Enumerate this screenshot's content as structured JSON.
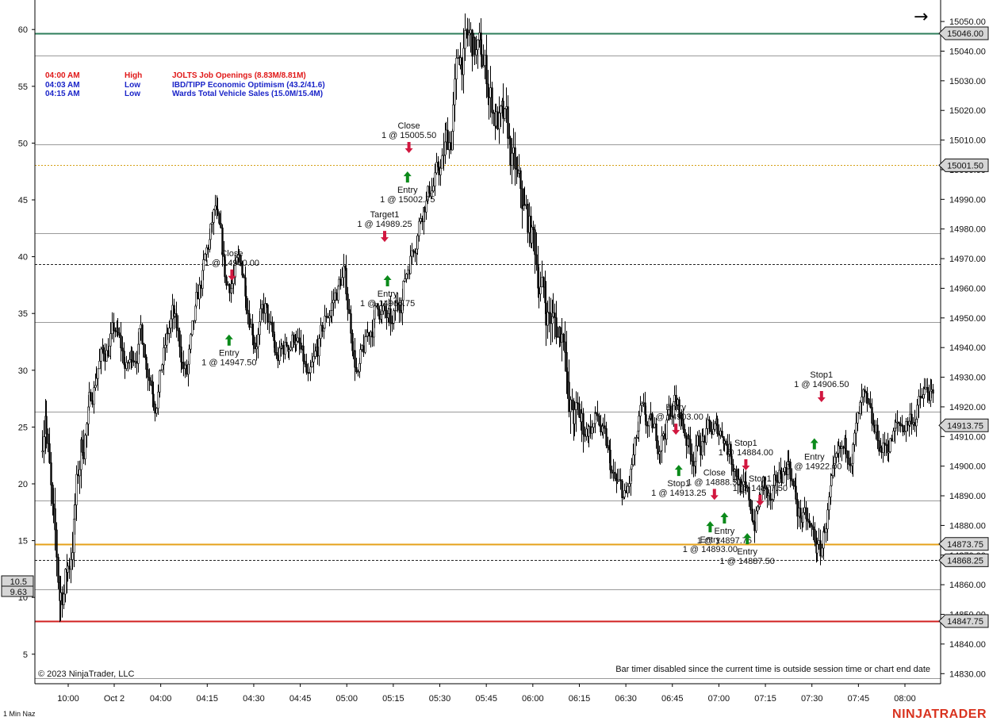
{
  "chart": {
    "instrument": "1 Min Naz",
    "copyright": "© 2023 NinjaTrader, LLC",
    "brand": "NINJATRADER",
    "bar_timer": "Bar timer disabled since the current time is outside session time or chart end date",
    "arrow_glyph": "→",
    "colors": {
      "bg": "#ffffff",
      "candle": "#000000",
      "green_line": "#2e7d5b",
      "red_line": "#d11f1f",
      "orange_line": "#e6a21a",
      "gold_dotted": "#d4a017",
      "brand": "#d9331f",
      "buy": "#0b8a1a",
      "sell": "#d1173f"
    }
  },
  "events": [
    {
      "time": "04:00 AM",
      "impact": "High",
      "title": "JOLTS Job Openings (8.83M/8.81M)",
      "color": "#e01818"
    },
    {
      "time": "04:03 AM",
      "impact": "Low",
      "title": "IBD/TIPP Economic Optimism (43.2/41.6)",
      "color": "#1a24c8"
    },
    {
      "time": "04:15 AM",
      "impact": "Low",
      "title": "Wards Total Vehicle Sales (15.0M/15.4M)",
      "color": "#1a24c8"
    }
  ],
  "chart_data": {
    "type": "candlestick",
    "x_ticks": [
      "10:00",
      "Oct 2",
      "04:00",
      "04:15",
      "04:30",
      "04:45",
      "05:00",
      "05:15",
      "05:30",
      "05:45",
      "06:00",
      "06:15",
      "06:30",
      "06:45",
      "07:00",
      "07:15",
      "07:30",
      "07:45",
      "08:00"
    ],
    "right_axis": {
      "ticks": [
        15050,
        15040,
        15030,
        15020,
        15010,
        15000,
        14990,
        14980,
        14970,
        14960,
        14950,
        14940,
        14930,
        14920,
        14910,
        14900,
        14890,
        14880,
        14870,
        14860,
        14850,
        14840,
        14830
      ],
      "range": [
        14826.6,
        15057.25
      ],
      "decimals": 2
    },
    "left_axis": {
      "ticks": [
        60,
        55,
        50,
        45,
        40,
        35,
        30,
        25,
        20,
        15,
        10,
        5
      ],
      "range": [
        2.4,
        62.6
      ]
    },
    "price_labels": [
      {
        "value": 15046.0,
        "style": "green"
      },
      {
        "value": 15001.5,
        "style": "gray"
      },
      {
        "value": 14913.75,
        "style": "gray"
      },
      {
        "value": 14873.75,
        "style": "gray"
      },
      {
        "value": 14868.25,
        "style": "gray"
      },
      {
        "value": 14847.75,
        "style": "gray"
      }
    ],
    "left_labels": [
      "10.5",
      "9.63"
    ],
    "levels": [
      {
        "value": 15046.0,
        "style": "green"
      },
      {
        "value": 15038.5,
        "style": "gray"
      },
      {
        "value": 15008.5,
        "style": "gray"
      },
      {
        "value": 15001.5,
        "style": "gold-dotted"
      },
      {
        "value": 14978.5,
        "style": "gray"
      },
      {
        "value": 14968.25,
        "style": "dashed"
      },
      {
        "value": 14948.5,
        "style": "gray"
      },
      {
        "value": 14918.5,
        "style": "gray"
      },
      {
        "value": 14888.5,
        "style": "gray"
      },
      {
        "value": 14873.75,
        "style": "orange"
      },
      {
        "value": 14868.25,
        "style": "dashed"
      },
      {
        "value": 14858.5,
        "style": "gray"
      },
      {
        "value": 14847.75,
        "style": "red"
      },
      {
        "value": 14828.5,
        "style": "gray"
      }
    ],
    "anchors": [
      {
        "t": 0,
        "p": 14905
      },
      {
        "t": 3,
        "p": 14925
      },
      {
        "t": 8,
        "p": 14880
      },
      {
        "t": 13,
        "p": 14855
      },
      {
        "t": 20,
        "p": 14868
      },
      {
        "t": 28,
        "p": 14905
      },
      {
        "t": 40,
        "p": 14935
      },
      {
        "t": 52,
        "p": 14945
      },
      {
        "t": 60,
        "p": 14932
      },
      {
        "t": 70,
        "p": 14945
      },
      {
        "t": 80,
        "p": 14925
      },
      {
        "t": 92,
        "p": 14950
      },
      {
        "t": 102,
        "p": 14930
      },
      {
        "t": 112,
        "p": 14960
      },
      {
        "t": 122,
        "p": 14985
      },
      {
        "t": 130,
        "p": 14960
      },
      {
        "t": 140,
        "p": 14968
      },
      {
        "t": 150,
        "p": 14945
      },
      {
        "t": 157,
        "p": 14952
      },
      {
        "t": 165,
        "p": 14935
      },
      {
        "t": 178,
        "p": 14945
      },
      {
        "t": 188,
        "p": 14925
      },
      {
        "t": 200,
        "p": 14950
      },
      {
        "t": 212,
        "p": 14965
      },
      {
        "t": 222,
        "p": 14930
      },
      {
        "t": 236,
        "p": 14955
      },
      {
        "t": 246,
        "p": 14945
      },
      {
        "t": 257,
        "p": 14968
      },
      {
        "t": 268,
        "p": 14990
      },
      {
        "t": 280,
        "p": 15000
      },
      {
        "t": 287,
        "p": 15012
      },
      {
        "t": 293,
        "p": 15038
      },
      {
        "t": 300,
        "p": 15042
      },
      {
        "t": 310,
        "p": 15035
      },
      {
        "t": 318,
        "p": 15020
      },
      {
        "t": 326,
        "p": 15010
      },
      {
        "t": 335,
        "p": 14990
      },
      {
        "t": 345,
        "p": 14975
      },
      {
        "t": 353,
        "p": 14955
      },
      {
        "t": 362,
        "p": 14945
      },
      {
        "t": 367,
        "p": 14948
      },
      {
        "t": 370,
        "p": 14918
      },
      {
        "t": 380,
        "p": 14912
      },
      {
        "t": 390,
        "p": 14916
      },
      {
        "t": 402,
        "p": 14893
      },
      {
        "t": 410,
        "p": 14888
      },
      {
        "t": 420,
        "p": 14915
      },
      {
        "t": 432,
        "p": 14908
      },
      {
        "t": 444,
        "p": 14922
      },
      {
        "t": 456,
        "p": 14905
      },
      {
        "t": 466,
        "p": 14910
      },
      {
        "t": 478,
        "p": 14912
      },
      {
        "t": 486,
        "p": 14902
      },
      {
        "t": 494,
        "p": 14888
      },
      {
        "t": 500,
        "p": 14882
      },
      {
        "t": 506,
        "p": 14893
      },
      {
        "t": 512,
        "p": 14885
      },
      {
        "t": 518,
        "p": 14897
      },
      {
        "t": 524,
        "p": 14903
      },
      {
        "t": 530,
        "p": 14885
      },
      {
        "t": 536,
        "p": 14880
      },
      {
        "t": 542,
        "p": 14874
      },
      {
        "t": 546,
        "p": 14870
      },
      {
        "t": 552,
        "p": 14888
      },
      {
        "t": 560,
        "p": 14900
      },
      {
        "t": 568,
        "p": 14908
      },
      {
        "t": 576,
        "p": 14920
      },
      {
        "t": 582,
        "p": 14910
      },
      {
        "t": 590,
        "p": 14906
      },
      {
        "t": 600,
        "p": 14912
      },
      {
        "t": 612,
        "p": 14918
      },
      {
        "t": 622,
        "p": 14925
      },
      {
        "t": 632,
        "p": 14910
      },
      {
        "t": 640,
        "p": 14904
      },
      {
        "t": 654,
        "p": 14915
      }
    ],
    "time_axis": {
      "bar_spacing": 1.8,
      "x_start": 53,
      "num_bars": 625
    },
    "trades": [
      {
        "kind": "sell",
        "bar": 133,
        "price": 14965,
        "label1": "Close",
        "label2": "1 @ 14960.00"
      },
      {
        "kind": "buy",
        "bar": 131,
        "price": 14942,
        "label1": "Entry",
        "label2": "1 @ 14947.50"
      },
      {
        "kind": "buy",
        "bar": 242,
        "price": 14962,
        "label1": "Entry",
        "label2": "1 @ 14966.75"
      },
      {
        "kind": "sell",
        "bar": 240,
        "price": 14978,
        "label1": "Target1",
        "label2": "1 @ 14989.25"
      },
      {
        "kind": "buy",
        "bar": 256,
        "price": 14997,
        "label1": "Entry",
        "label2": "1 @ 15002.75"
      },
      {
        "kind": "sell",
        "bar": 257,
        "price": 15008,
        "label1": "Close",
        "label2": "1 @ 15005.50"
      },
      {
        "kind": "sell",
        "bar": 444,
        "price": 14913,
        "label1": "Entry",
        "label2": "1 @ 14903.00"
      },
      {
        "kind": "buy",
        "bar": 446,
        "price": 14898,
        "label1": "Stop1",
        "label2": "1 @ 14913.25"
      },
      {
        "kind": "sell",
        "bar": 471,
        "price": 14891,
        "label1": "Close",
        "label2": "1 @ 14888.50"
      },
      {
        "kind": "buy",
        "bar": 468,
        "price": 14879,
        "label1": "Entry",
        "label2": "1 @ 14893.00"
      },
      {
        "kind": "buy",
        "bar": 478,
        "price": 14882,
        "label1": "Entry",
        "label2": "1 @ 14897.75"
      },
      {
        "kind": "sell",
        "bar": 493,
        "price": 14901,
        "label1": "Stop1",
        "label2": "1 @ 14884.00"
      },
      {
        "kind": "sell",
        "bar": 503,
        "price": 14889,
        "label1": "Stop1",
        "label2": "1 @ 14877.50"
      },
      {
        "kind": "buy",
        "bar": 494,
        "price": 14875,
        "label1": "Entry",
        "label2": "1 @ 14887.50"
      },
      {
        "kind": "sell",
        "bar": 546,
        "price": 14924,
        "label1": "Stop1",
        "label2": "1 @ 14906.50"
      },
      {
        "kind": "buy",
        "bar": 541,
        "price": 14907,
        "label1": "Entry",
        "label2": "1 @ 14922.00"
      }
    ]
  }
}
